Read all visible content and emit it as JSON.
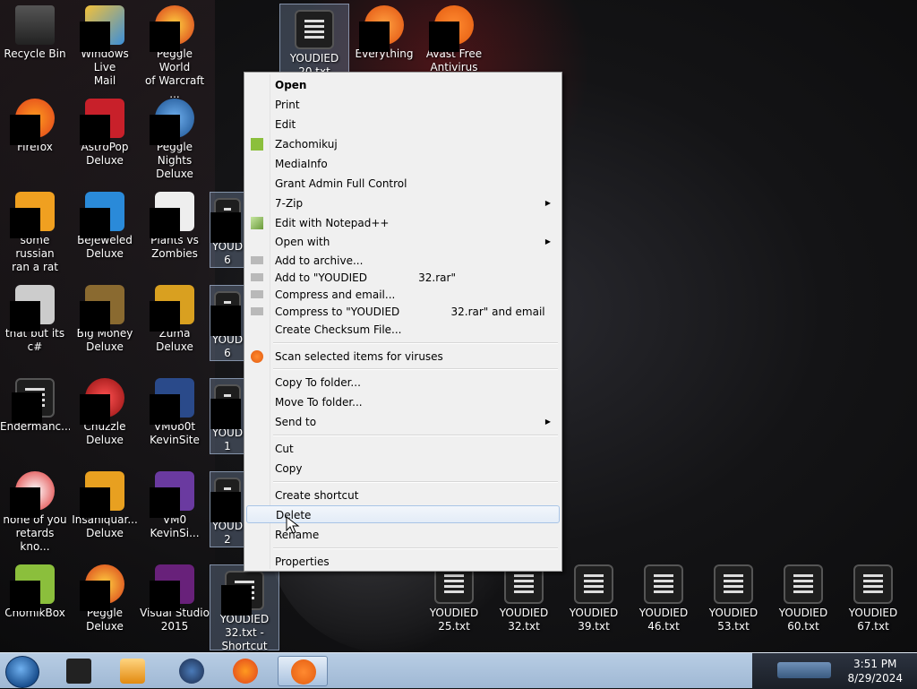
{
  "desktop": {
    "icons": [
      {
        "label1": "Recycle Bin",
        "label2": ""
      },
      {
        "label1": "Windows Live",
        "label2": "Mail"
      },
      {
        "label1": "Peggle World",
        "label2": "of Warcraft ..."
      },
      {
        "label1": "YOUDIED",
        "label2": "20.txt"
      },
      {
        "label1": "Everything",
        "label2": ""
      },
      {
        "label1": "Avast Free",
        "label2": "Antivirus"
      },
      {
        "label1": "Firefox",
        "label2": ""
      },
      {
        "label1": "AstroPop",
        "label2": "Deluxe"
      },
      {
        "label1": "Peggle Nights",
        "label2": "Deluxe"
      },
      {
        "label1": "some russian",
        "label2": "ran a rat"
      },
      {
        "label1": "Bejeweled",
        "label2": "Deluxe"
      },
      {
        "label1": "Plants vs",
        "label2": "Zombies"
      },
      {
        "label1": "YOUD",
        "label2": "6"
      },
      {
        "label1": "that but its c#",
        "label2": ""
      },
      {
        "label1": "Big Money",
        "label2": "Deluxe"
      },
      {
        "label1": "Zuma Deluxe",
        "label2": ""
      },
      {
        "label1": "YOUD",
        "label2": "6"
      },
      {
        "label1": "Endermanc...",
        "label2": ""
      },
      {
        "label1": "Chuzzle",
        "label2": "Deluxe"
      },
      {
        "label1": "VM0b0t",
        "label2": "KevinSite"
      },
      {
        "label1": "YOUD",
        "label2": "1"
      },
      {
        "label1": "none of you",
        "label2": "retards kno..."
      },
      {
        "label1": "Insaniquar...",
        "label2": "Deluxe"
      },
      {
        "label1": "VM0",
        "label2": "KevinSi..."
      },
      {
        "label1": "YOUD",
        "label2": "2"
      },
      {
        "label1": "ChomikBox",
        "label2": ""
      },
      {
        "label1": "Peggle Deluxe",
        "label2": ""
      },
      {
        "label1": "Visual Studio",
        "label2": "2015"
      },
      {
        "label1": "YOUDIED",
        "label2": "32.txt -",
        "label3": "Shortcut"
      },
      {
        "label1": "YOUDIED",
        "label2": "25.txt"
      },
      {
        "label1": "YOUDIED",
        "label2": "32.txt"
      },
      {
        "label1": "YOUDIED",
        "label2": "39.txt"
      },
      {
        "label1": "YOUDIED",
        "label2": "46.txt"
      },
      {
        "label1": "YOUDIED",
        "label2": "53.txt"
      },
      {
        "label1": "YOUDIED",
        "label2": "60.txt"
      },
      {
        "label1": "YOUDIED",
        "label2": "67.txt"
      }
    ]
  },
  "context_menu": {
    "items": [
      "Open",
      "Print",
      "Edit",
      "Zachomikuj",
      "MediaInfo",
      "Grant Admin Full Control",
      "7-Zip",
      "Edit with Notepad++",
      "Open with",
      "Add to archive...",
      "Add to \"YOUDIED               32.rar\"",
      "Compress and email...",
      "Compress to \"YOUDIED               32.rar\" and email",
      "Create Checksum File...",
      "Scan selected items for viruses",
      "Copy To folder...",
      "Move To folder...",
      "Send to",
      "Cut",
      "Copy",
      "Create shortcut",
      "Delete",
      "Rename",
      "Properties"
    ],
    "hovered": "Delete"
  },
  "taskbar": {
    "time": "3:51 PM",
    "date": "8/29/2024"
  },
  "colors": {
    "menu_bg": "#f0f0f0",
    "hover_border": "#a8c4e6",
    "taskbar": "#b8cde4"
  }
}
